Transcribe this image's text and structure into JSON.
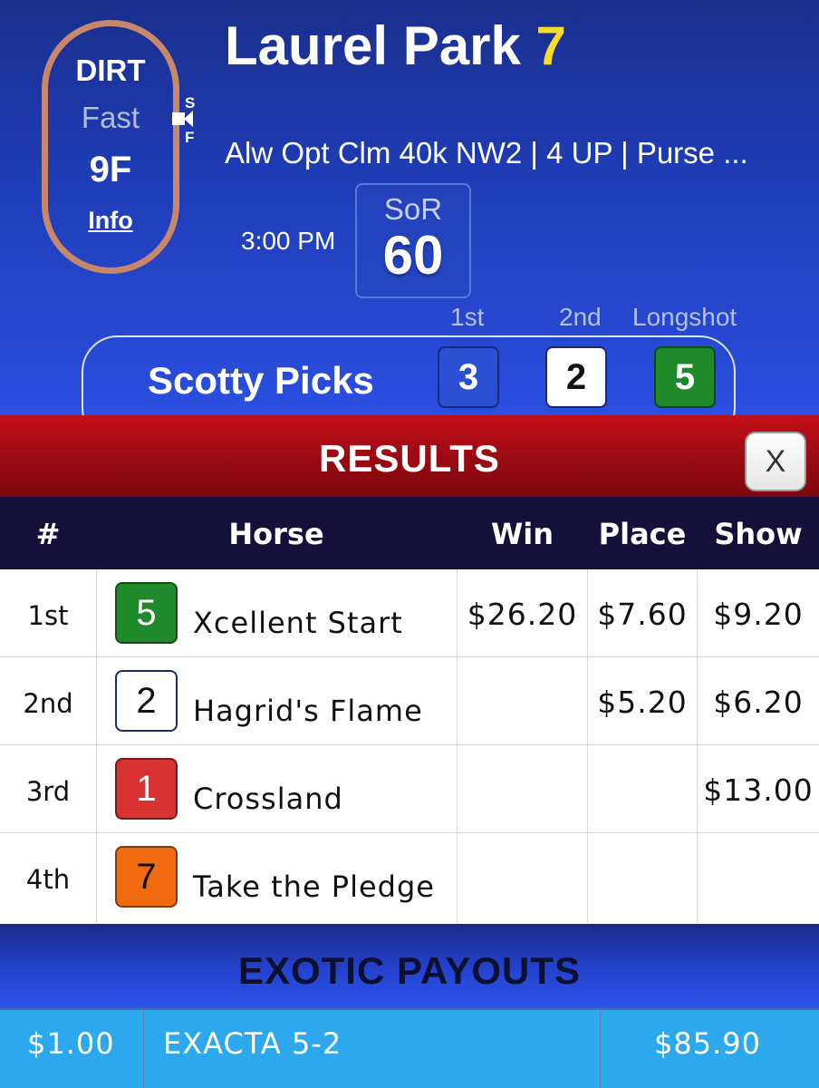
{
  "track": {
    "surface": "DIRT",
    "condition": "Fast",
    "distance": "9F",
    "info_link": "Info",
    "start_marker": "S",
    "finish_marker": "F",
    "surface_color": "#c8876a"
  },
  "race": {
    "track_name": "Laurel Park",
    "race_number": "7",
    "description": "Alw Opt Clm 40k NW2 | 4 UP | Purse ...",
    "post_time": "3:00 PM",
    "sor_label": "SoR",
    "sor_value": "60"
  },
  "picks": {
    "title": "Scotty Picks",
    "labels": {
      "first": "1st",
      "second": "2nd",
      "longshot": "Longshot"
    },
    "first": "3",
    "second": "2",
    "longshot": "5"
  },
  "results": {
    "title": "RESULTS",
    "close_label": "X",
    "columns": [
      "#",
      "Horse",
      "Win",
      "Place",
      "Show"
    ],
    "rows": [
      {
        "position": "1st",
        "number": "5",
        "saddle_color": "#1f8a2a",
        "saddle_text": "#ffffff",
        "horse": "Xcellent Start",
        "win": "$26.20",
        "place": "$7.60",
        "show": "$9.20"
      },
      {
        "position": "2nd",
        "number": "2",
        "saddle_color": "#ffffff",
        "saddle_text": "#111111",
        "horse": "Hagrid's Flame",
        "win": "",
        "place": "$5.20",
        "show": "$6.20"
      },
      {
        "position": "3rd",
        "number": "1",
        "saddle_color": "#d83232",
        "saddle_text": "#ffffff",
        "horse": "Crossland",
        "win": "",
        "place": "",
        "show": "$13.00"
      },
      {
        "position": "4th",
        "number": "7",
        "saddle_color": "#f26a10",
        "saddle_text": "#111111",
        "horse": "Take the Pledge",
        "win": "",
        "place": "",
        "show": ""
      }
    ]
  },
  "exotic": {
    "title": "EXOTIC PAYOUTS",
    "rows": [
      {
        "wager": "$1.00",
        "bet": "EXACTA 5-2",
        "payout": "$85.90"
      }
    ]
  },
  "colors": {
    "header_blue": "#1f3db8",
    "results_red": "#a00b14",
    "table_header": "#14103a",
    "race_number_yellow": "#f7dc2a",
    "exotic_row": "#2ea8ec"
  }
}
